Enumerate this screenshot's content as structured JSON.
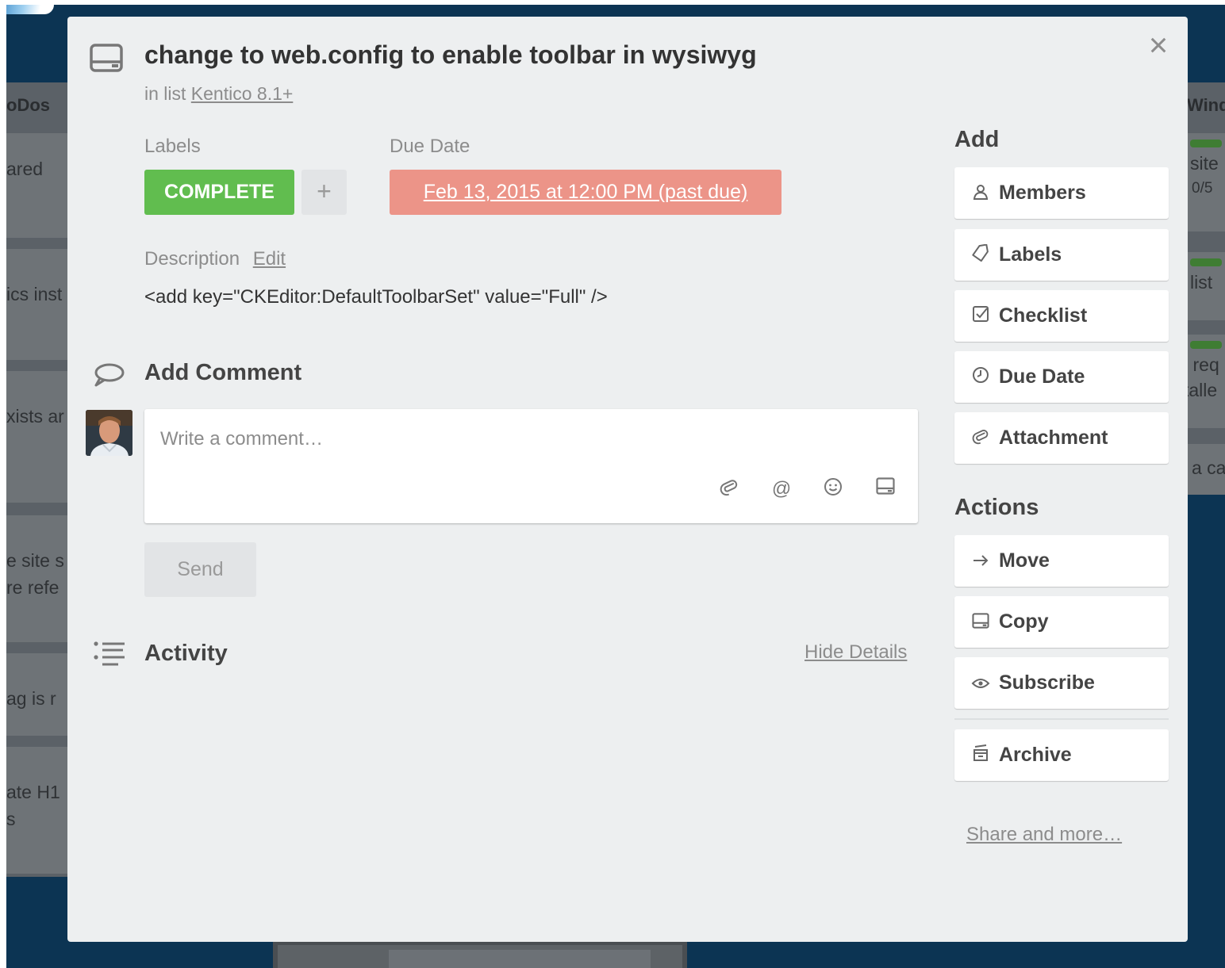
{
  "background": {
    "left_list_title": "oDos",
    "left_cards": [
      [
        "ared"
      ],
      [
        "ics inst"
      ],
      [
        "xists ar"
      ],
      [
        "e site s",
        "re refe"
      ],
      [
        "ag is r"
      ],
      [
        "ate H1",
        "s"
      ]
    ],
    "right_list_title": "Wind",
    "right_cards": [
      [
        "site",
        "0/5"
      ],
      [
        "list"
      ],
      [
        "l req",
        "talle"
      ],
      [
        "a ca"
      ]
    ]
  },
  "card": {
    "close_symbol": "×",
    "title": "change to web.config to enable toolbar in wysiwyg",
    "in_list_prefix": "in list",
    "list_name": "Kentico 8.1+",
    "labels_heading": "Labels",
    "label_complete": "COMPLETE",
    "label_add_symbol": "+",
    "due_date_heading": "Due Date",
    "due_date_value": "Feb 13, 2015 at 12:00 PM (past due)",
    "description_heading": "Description",
    "description_edit": "Edit",
    "description_text": "<add key=\"CKEditor:DefaultToolbarSet\" value=\"Full\" />"
  },
  "comment": {
    "heading": "Add Comment",
    "placeholder": "Write a comment…",
    "send_label": "Send"
  },
  "activity": {
    "heading": "Activity",
    "hide_details": "Hide Details"
  },
  "sidebar": {
    "add_heading": "Add",
    "add_buttons": [
      {
        "label": "Members",
        "icon": "person-icon"
      },
      {
        "label": "Labels",
        "icon": "tag-icon"
      },
      {
        "label": "Checklist",
        "icon": "checkbox-icon"
      },
      {
        "label": "Due Date",
        "icon": "clock-icon"
      },
      {
        "label": "Attachment",
        "icon": "paperclip-icon"
      }
    ],
    "actions_heading": "Actions",
    "action_buttons": [
      {
        "label": "Move",
        "icon": "arrow-right-icon"
      },
      {
        "label": "Copy",
        "icon": "card-icon"
      },
      {
        "label": "Subscribe",
        "icon": "eye-icon"
      },
      {
        "label": "Archive",
        "icon": "archive-icon"
      }
    ],
    "share_more": "Share and more…"
  },
  "colors": {
    "board_bg": "#0c3453",
    "modal_bg": "#edeff0",
    "label_green": "#61bd4f",
    "due_past": "#ec9488"
  }
}
